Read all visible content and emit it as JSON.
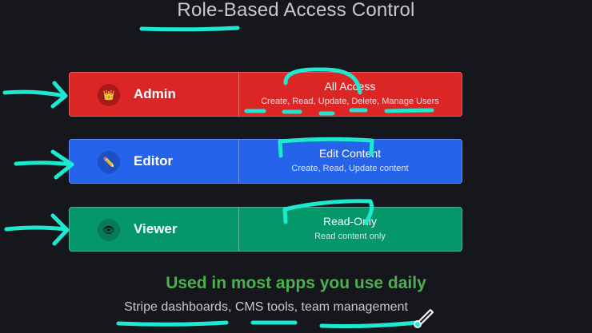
{
  "title": "Role-Based Access Control",
  "roles": [
    {
      "name": "Admin",
      "icon": "crown-icon",
      "icon_glyph": "👑",
      "access": "All Access",
      "permissions": "Create, Read, Update, Delete, Manage Users",
      "color": "#dc2626"
    },
    {
      "name": "Editor",
      "icon": "pencil-icon",
      "icon_glyph": "✏️",
      "access": "Edit Content",
      "permissions": "Create, Read, Update content",
      "color": "#2563eb"
    },
    {
      "name": "Viewer",
      "icon": "eye-icon",
      "icon_glyph": "👁",
      "access": "Read-Only",
      "permissions": "Read content only",
      "color": "#059669"
    }
  ],
  "tagline": "Used in most apps you use daily",
  "examples": "Stripe dashboards, CMS tools, team management",
  "colors": {
    "background": "#15171c",
    "annotation": "#1de9d0",
    "tagline": "#4caf50"
  }
}
